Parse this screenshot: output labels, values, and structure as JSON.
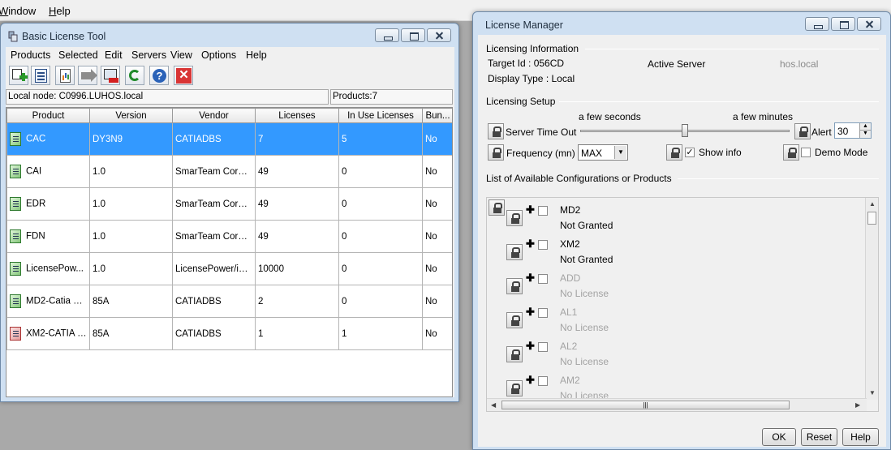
{
  "app_menu": {
    "window": "Window",
    "help": "Help"
  },
  "basic_license_tool": {
    "title": "Basic License Tool",
    "menu": [
      "Products",
      "Selected",
      "Edit",
      "Servers",
      "View",
      "Options",
      "Help"
    ],
    "toolbar": [
      "add-product-icon",
      "properties-icon",
      "report-icon",
      "export-icon",
      "remove-server-icon",
      "refresh-icon",
      "help-icon",
      "close-icon"
    ],
    "status_local_node": "Local node: C0996.LUHOS.local",
    "status_products": "Products:7",
    "columns": [
      "Product",
      "Version",
      "Vendor",
      "Licenses",
      "In Use Licenses",
      "Bun..."
    ],
    "rows": [
      {
        "product": "CAC",
        "version": "DY3N9",
        "vendor": "CATIADBS",
        "licenses": "7",
        "in_use": "5",
        "bundle": "No",
        "icon": "product-green-icon"
      },
      {
        "product": "CAI",
        "version": "1.0",
        "vendor": "SmarTeam Corpor...",
        "licenses": "49",
        "in_use": "0",
        "bundle": "No",
        "icon": "product-green-icon"
      },
      {
        "product": "EDR",
        "version": "1.0",
        "vendor": "SmarTeam Corpor...",
        "licenses": "49",
        "in_use": "0",
        "bundle": "No",
        "icon": "product-green-icon"
      },
      {
        "product": "FDN",
        "version": "1.0",
        "vendor": "SmarTeam Corpor...",
        "licenses": "49",
        "in_use": "0",
        "bundle": "No",
        "icon": "product-green-icon"
      },
      {
        "product": "LicensePow...",
        "version": "1.0",
        "vendor": "LicensePower/iFO...",
        "licenses": "10000",
        "in_use": "0",
        "bundle": "No",
        "icon": "product-green-icon"
      },
      {
        "product": "MD2-Catia M...",
        "version": "85A",
        "vendor": "CATIADBS",
        "licenses": "2",
        "in_use": "0",
        "bundle": "No",
        "icon": "product-green-icon"
      },
      {
        "product": "XM2-CATIA E...",
        "version": "85A",
        "vendor": "CATIADBS",
        "licenses": "1",
        "in_use": "1",
        "bundle": "No",
        "icon": "product-red-icon"
      }
    ]
  },
  "license_manager": {
    "title": "License  Manager",
    "info_header": "Licensing Information",
    "target_id": "Target Id : 056CD",
    "display_type": "Display Type : Local",
    "active_server": "Active Server",
    "active_server_value": "hos.local",
    "setup_header": "Licensing Setup",
    "slider_min_label": "a few seconds",
    "slider_max_label": "a few minutes",
    "slider_level": 0.5,
    "server_timeout_label": "Server Time Out",
    "alert_label": "Alert",
    "alert_value": "30",
    "frequency_label": "Frequency (mn)",
    "frequency_value": "MAX",
    "show_info_label": "Show info",
    "show_info_checked": true,
    "demo_mode_label": "Demo Mode",
    "demo_mode_checked": false,
    "list_header": "List of Available Configurations or Products",
    "items": [
      {
        "name": "MD2",
        "status": "Not Granted",
        "dim": false
      },
      {
        "name": "XM2",
        "status": "Not Granted",
        "dim": false
      },
      {
        "name": "ADD",
        "status": "No License",
        "dim": true
      },
      {
        "name": "AL1",
        "status": "No License",
        "dim": true
      },
      {
        "name": "AL2",
        "status": "No License",
        "dim": true
      },
      {
        "name": "AM2",
        "status": "No License",
        "dim": true
      }
    ],
    "buttons": {
      "ok": "OK",
      "reset": "Reset",
      "help": "Help"
    }
  }
}
